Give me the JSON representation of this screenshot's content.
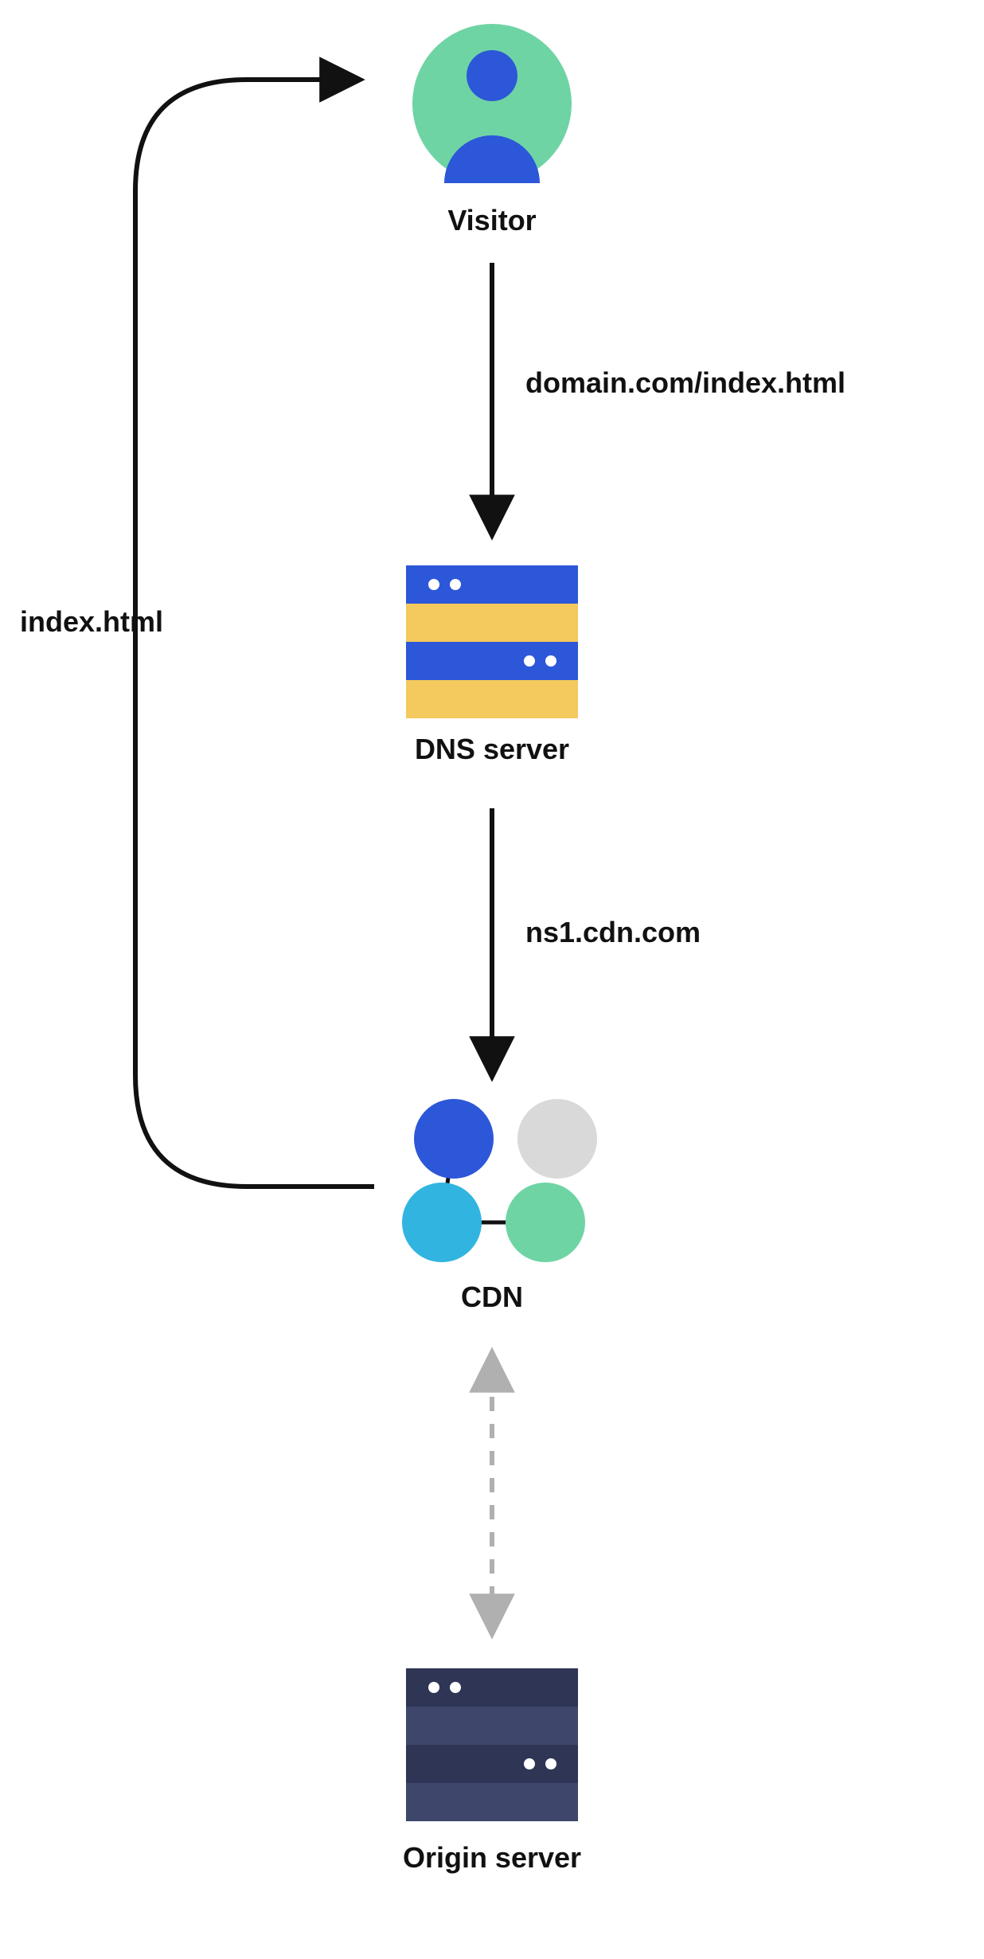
{
  "nodes": {
    "visitor": {
      "label": "Visitor"
    },
    "dns": {
      "label": "DNS server"
    },
    "cdn": {
      "label": "CDN"
    },
    "origin": {
      "label": "Origin server"
    }
  },
  "edges": {
    "visitor_to_dns": {
      "label": "domain.com/index.html"
    },
    "dns_to_cdn": {
      "label": "ns1.cdn.com"
    },
    "cdn_to_visitor": {
      "label": "index.html"
    }
  },
  "colors": {
    "mint": "#6FD4A4",
    "blue": "#2C57D8",
    "yellow": "#F4C95D",
    "cyan": "#31B5E0",
    "grey": "#D9D9D9",
    "navy": "#2E3555",
    "arrow_grey": "#B0B0B0"
  }
}
